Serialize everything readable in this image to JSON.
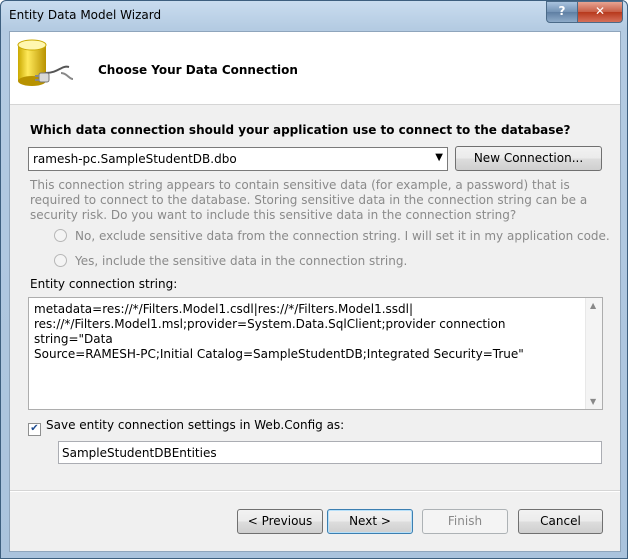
{
  "window": {
    "title": "Entity Data Model Wizard",
    "help_glyph": "?",
    "close_glyph": "✕"
  },
  "header": {
    "icon": "database-plug-icon",
    "title": "Choose Your Data Connection"
  },
  "connection": {
    "question": "Which data connection should your application use to connect to the database?",
    "selected": "ramesh-pc.SampleStudentDB.dbo",
    "new_connection_label": "New Connection..."
  },
  "sensitive": {
    "message": "This connection string appears to contain sensitive data (for example, a password) that is required to connect to the database. Storing sensitive data in the connection string can be a security risk. Do you want to include this sensitive data in the connection string?",
    "option_exclude": "No, exclude sensitive data from the connection string. I will set it in my application code.",
    "option_include": "Yes, include the sensitive data in the connection string."
  },
  "entity_connection": {
    "label": "Entity connection string:",
    "value_lines": [
      "metadata=res://*/Filters.Model1.csdl|res://*/Filters.Model1.ssdl|",
      "res://*/Filters.Model1.msl;provider=System.Data.SqlClient;provider connection string=\"Data",
      "Source=RAMESH-PC;Initial Catalog=SampleStudentDB;Integrated Security=True\""
    ]
  },
  "save_settings": {
    "checked": true,
    "label": "Save entity connection settings in Web.Config as:",
    "value": "SampleStudentDBEntities"
  },
  "buttons": {
    "previous": "< Previous",
    "next": "Next >",
    "finish": "Finish",
    "cancel": "Cancel"
  },
  "colors": {
    "title_bar": "#b4cbe2",
    "close_button": "#c75d45",
    "dialog_background": "#f0f0f0",
    "disabled_text": "#8a8a8a"
  }
}
